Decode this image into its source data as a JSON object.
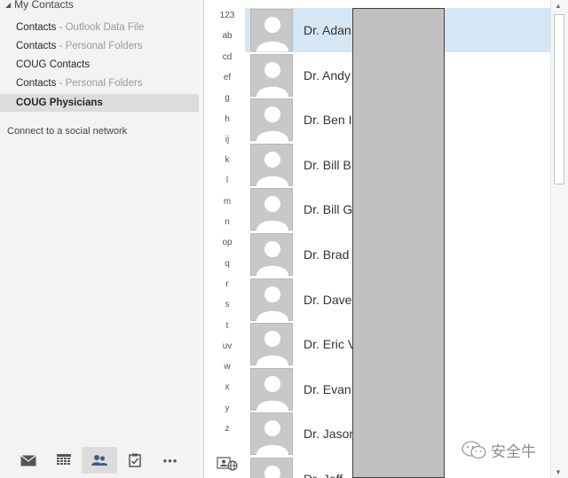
{
  "nav": {
    "group_header": "My Contacts",
    "folders": [
      {
        "name": "Contacts",
        "store": " - Outlook Data File"
      },
      {
        "name": "Contacts",
        "store": " - Personal Folders"
      },
      {
        "name": "COUG Contacts",
        "store": ""
      },
      {
        "name": "Contacts",
        "store": " - Personal Folders"
      },
      {
        "name": "COUG Physicians",
        "store": ""
      }
    ],
    "social_link": "Connect to a social network",
    "bottom_icons": [
      "mail-icon",
      "calendar-icon",
      "people-icon",
      "tasks-icon",
      "more-icon"
    ],
    "more_label": "•••"
  },
  "alpha_index": [
    "123",
    "ab",
    "cd",
    "ef",
    "g",
    "h",
    "ij",
    "k",
    "l",
    "m",
    "n",
    "op",
    "q",
    "r",
    "s",
    "t",
    "uv",
    "w",
    "x",
    "y",
    "z"
  ],
  "contacts": [
    {
      "name": "Dr. Adan"
    },
    {
      "name": "Dr. Andy"
    },
    {
      "name": "Dr. Ben I"
    },
    {
      "name": "Dr. Bill B"
    },
    {
      "name": "Dr. Bill G"
    },
    {
      "name": "Dr. Brad"
    },
    {
      "name": "Dr. Dave"
    },
    {
      "name": "Dr. Eric V"
    },
    {
      "name": "Dr. Evan"
    },
    {
      "name": "Dr. Jason"
    },
    {
      "name": "Dr. Jeff"
    }
  ],
  "watermark": {
    "text": "安全牛"
  },
  "colors": {
    "selected_row": "#d5e6f4",
    "nav_selected": "#dcdcdc",
    "redaction": "#c0c0c0"
  }
}
